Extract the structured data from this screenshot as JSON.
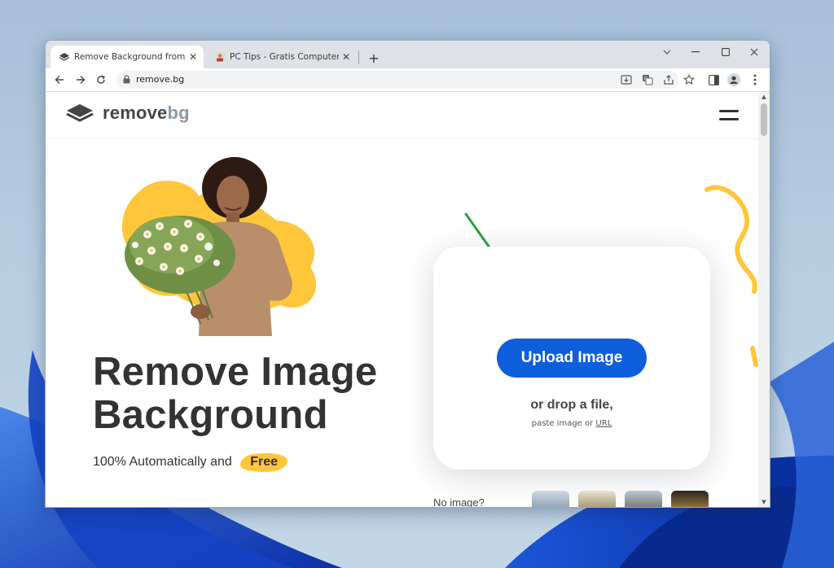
{
  "browser": {
    "tabs": [
      {
        "label": "Remove Background from Image",
        "active": true
      },
      {
        "label": "PC Tips - Gratis Computer Tips, ins",
        "active": false
      }
    ],
    "tab_close": "✕",
    "new_tab": "+",
    "url": "remove.bg",
    "window_controls": [
      "chevron-down-icon",
      "minimize-icon",
      "maximize-icon",
      "close-icon"
    ]
  },
  "site": {
    "logo": {
      "word1": "remove",
      "word2": "bg"
    },
    "headline_line1": "Remove Image",
    "headline_line2": "Background",
    "subline": "100% Automatically and",
    "free_badge": "Free",
    "upload_button": "Upload Image",
    "drop_text": "or drop a file,",
    "paste_text": "paste image or",
    "paste_link": "URL",
    "no_image": "No image?"
  },
  "colors": {
    "accent_blue": "#0f5fdc",
    "accent_yellow": "#ffc63b",
    "arrow_green": "#2aa43c"
  }
}
